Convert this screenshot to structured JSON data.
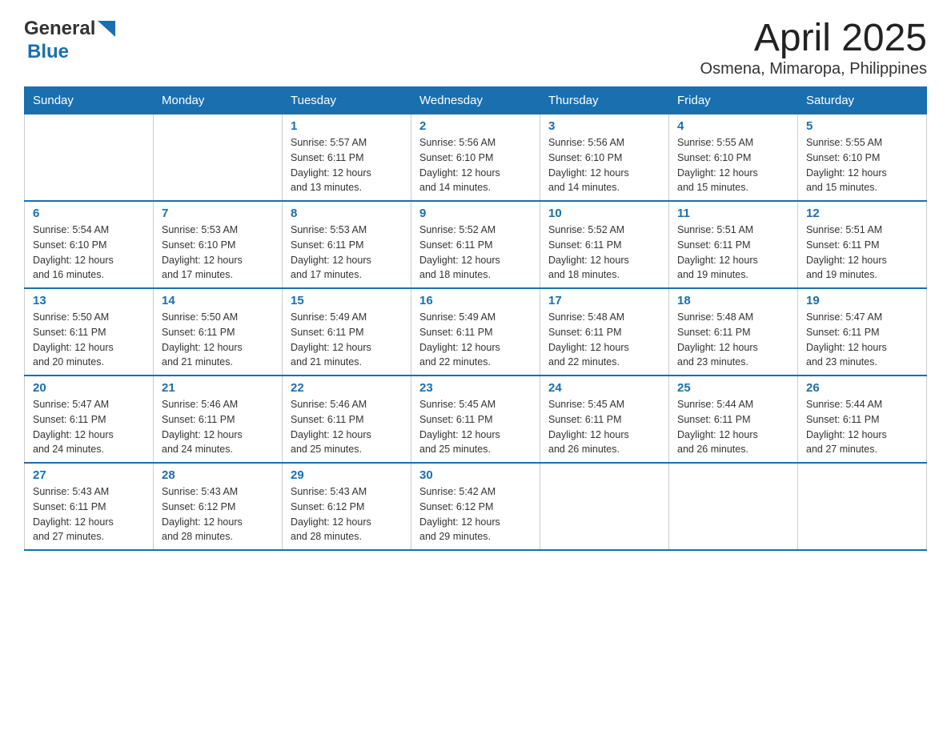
{
  "header": {
    "logo_general": "General",
    "logo_blue": "Blue",
    "title": "April 2025",
    "subtitle": "Osmena, Mimaropa, Philippines"
  },
  "calendar": {
    "days_of_week": [
      "Sunday",
      "Monday",
      "Tuesday",
      "Wednesday",
      "Thursday",
      "Friday",
      "Saturday"
    ],
    "weeks": [
      [
        {
          "day": "",
          "info": ""
        },
        {
          "day": "",
          "info": ""
        },
        {
          "day": "1",
          "info": "Sunrise: 5:57 AM\nSunset: 6:11 PM\nDaylight: 12 hours\nand 13 minutes."
        },
        {
          "day": "2",
          "info": "Sunrise: 5:56 AM\nSunset: 6:10 PM\nDaylight: 12 hours\nand 14 minutes."
        },
        {
          "day": "3",
          "info": "Sunrise: 5:56 AM\nSunset: 6:10 PM\nDaylight: 12 hours\nand 14 minutes."
        },
        {
          "day": "4",
          "info": "Sunrise: 5:55 AM\nSunset: 6:10 PM\nDaylight: 12 hours\nand 15 minutes."
        },
        {
          "day": "5",
          "info": "Sunrise: 5:55 AM\nSunset: 6:10 PM\nDaylight: 12 hours\nand 15 minutes."
        }
      ],
      [
        {
          "day": "6",
          "info": "Sunrise: 5:54 AM\nSunset: 6:10 PM\nDaylight: 12 hours\nand 16 minutes."
        },
        {
          "day": "7",
          "info": "Sunrise: 5:53 AM\nSunset: 6:10 PM\nDaylight: 12 hours\nand 17 minutes."
        },
        {
          "day": "8",
          "info": "Sunrise: 5:53 AM\nSunset: 6:11 PM\nDaylight: 12 hours\nand 17 minutes."
        },
        {
          "day": "9",
          "info": "Sunrise: 5:52 AM\nSunset: 6:11 PM\nDaylight: 12 hours\nand 18 minutes."
        },
        {
          "day": "10",
          "info": "Sunrise: 5:52 AM\nSunset: 6:11 PM\nDaylight: 12 hours\nand 18 minutes."
        },
        {
          "day": "11",
          "info": "Sunrise: 5:51 AM\nSunset: 6:11 PM\nDaylight: 12 hours\nand 19 minutes."
        },
        {
          "day": "12",
          "info": "Sunrise: 5:51 AM\nSunset: 6:11 PM\nDaylight: 12 hours\nand 19 minutes."
        }
      ],
      [
        {
          "day": "13",
          "info": "Sunrise: 5:50 AM\nSunset: 6:11 PM\nDaylight: 12 hours\nand 20 minutes."
        },
        {
          "day": "14",
          "info": "Sunrise: 5:50 AM\nSunset: 6:11 PM\nDaylight: 12 hours\nand 21 minutes."
        },
        {
          "day": "15",
          "info": "Sunrise: 5:49 AM\nSunset: 6:11 PM\nDaylight: 12 hours\nand 21 minutes."
        },
        {
          "day": "16",
          "info": "Sunrise: 5:49 AM\nSunset: 6:11 PM\nDaylight: 12 hours\nand 22 minutes."
        },
        {
          "day": "17",
          "info": "Sunrise: 5:48 AM\nSunset: 6:11 PM\nDaylight: 12 hours\nand 22 minutes."
        },
        {
          "day": "18",
          "info": "Sunrise: 5:48 AM\nSunset: 6:11 PM\nDaylight: 12 hours\nand 23 minutes."
        },
        {
          "day": "19",
          "info": "Sunrise: 5:47 AM\nSunset: 6:11 PM\nDaylight: 12 hours\nand 23 minutes."
        }
      ],
      [
        {
          "day": "20",
          "info": "Sunrise: 5:47 AM\nSunset: 6:11 PM\nDaylight: 12 hours\nand 24 minutes."
        },
        {
          "day": "21",
          "info": "Sunrise: 5:46 AM\nSunset: 6:11 PM\nDaylight: 12 hours\nand 24 minutes."
        },
        {
          "day": "22",
          "info": "Sunrise: 5:46 AM\nSunset: 6:11 PM\nDaylight: 12 hours\nand 25 minutes."
        },
        {
          "day": "23",
          "info": "Sunrise: 5:45 AM\nSunset: 6:11 PM\nDaylight: 12 hours\nand 25 minutes."
        },
        {
          "day": "24",
          "info": "Sunrise: 5:45 AM\nSunset: 6:11 PM\nDaylight: 12 hours\nand 26 minutes."
        },
        {
          "day": "25",
          "info": "Sunrise: 5:44 AM\nSunset: 6:11 PM\nDaylight: 12 hours\nand 26 minutes."
        },
        {
          "day": "26",
          "info": "Sunrise: 5:44 AM\nSunset: 6:11 PM\nDaylight: 12 hours\nand 27 minutes."
        }
      ],
      [
        {
          "day": "27",
          "info": "Sunrise: 5:43 AM\nSunset: 6:11 PM\nDaylight: 12 hours\nand 27 minutes."
        },
        {
          "day": "28",
          "info": "Sunrise: 5:43 AM\nSunset: 6:12 PM\nDaylight: 12 hours\nand 28 minutes."
        },
        {
          "day": "29",
          "info": "Sunrise: 5:43 AM\nSunset: 6:12 PM\nDaylight: 12 hours\nand 28 minutes."
        },
        {
          "day": "30",
          "info": "Sunrise: 5:42 AM\nSunset: 6:12 PM\nDaylight: 12 hours\nand 29 minutes."
        },
        {
          "day": "",
          "info": ""
        },
        {
          "day": "",
          "info": ""
        },
        {
          "day": "",
          "info": ""
        }
      ]
    ]
  }
}
